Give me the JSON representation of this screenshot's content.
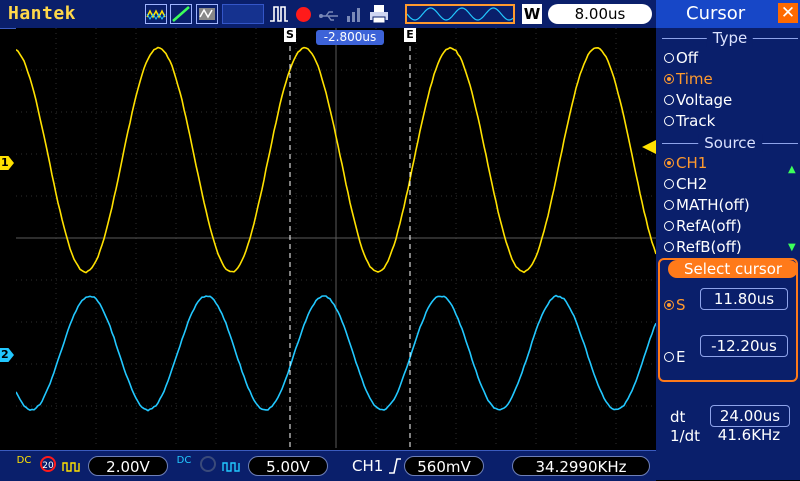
{
  "brand": "Hantek",
  "toolbar": {
    "icons": [
      "waveform-display-icon",
      "ramp-icon",
      "persistence-icon",
      "pulse-icon",
      "stop-icon",
      "usb-icon",
      "signal-bars-icon",
      "print-icon"
    ],
    "window_label": "W",
    "timebase": "8.00us"
  },
  "cursors": {
    "s_marker": "S",
    "e_marker": "E",
    "trigger_position": "-2.800us"
  },
  "channels": {
    "ch1_marker": "1",
    "ch2_marker": "2",
    "ch1_color": "#ffe100",
    "ch2_color": "#22c8ff"
  },
  "bottom": {
    "ch1_coupling": "DC",
    "ch1_bw_limit": "20",
    "ch1_volts": "2.00V",
    "ch2_coupling": "DC",
    "ch2_volts": "5.00V",
    "trigger_source": "CH1",
    "trigger_level": "560mV",
    "frequency": "34.2990KHz"
  },
  "panel": {
    "title": "Cursor",
    "type_header": "Type",
    "type_options": [
      "Off",
      "Time",
      "Voltage",
      "Track"
    ],
    "type_selected": "Time",
    "source_header": "Source",
    "source_options": [
      "CH1",
      "CH2",
      "MATH(off)",
      "RefA(off)",
      "RefB(off)"
    ],
    "source_selected": "CH1",
    "select_header": "Select cursor",
    "s_label": "S",
    "s_value": "11.80us",
    "e_label": "E",
    "e_value": "-12.20us",
    "dt_label": "dt",
    "dt_value": "24.00us",
    "inv_dt_label": "1/dt",
    "inv_dt_value": "41.6KHz"
  },
  "accent_colors": {
    "selected": "#ff9a2e",
    "panel_bg": "#0a1f6b",
    "title_bg": "#1747c7"
  }
}
